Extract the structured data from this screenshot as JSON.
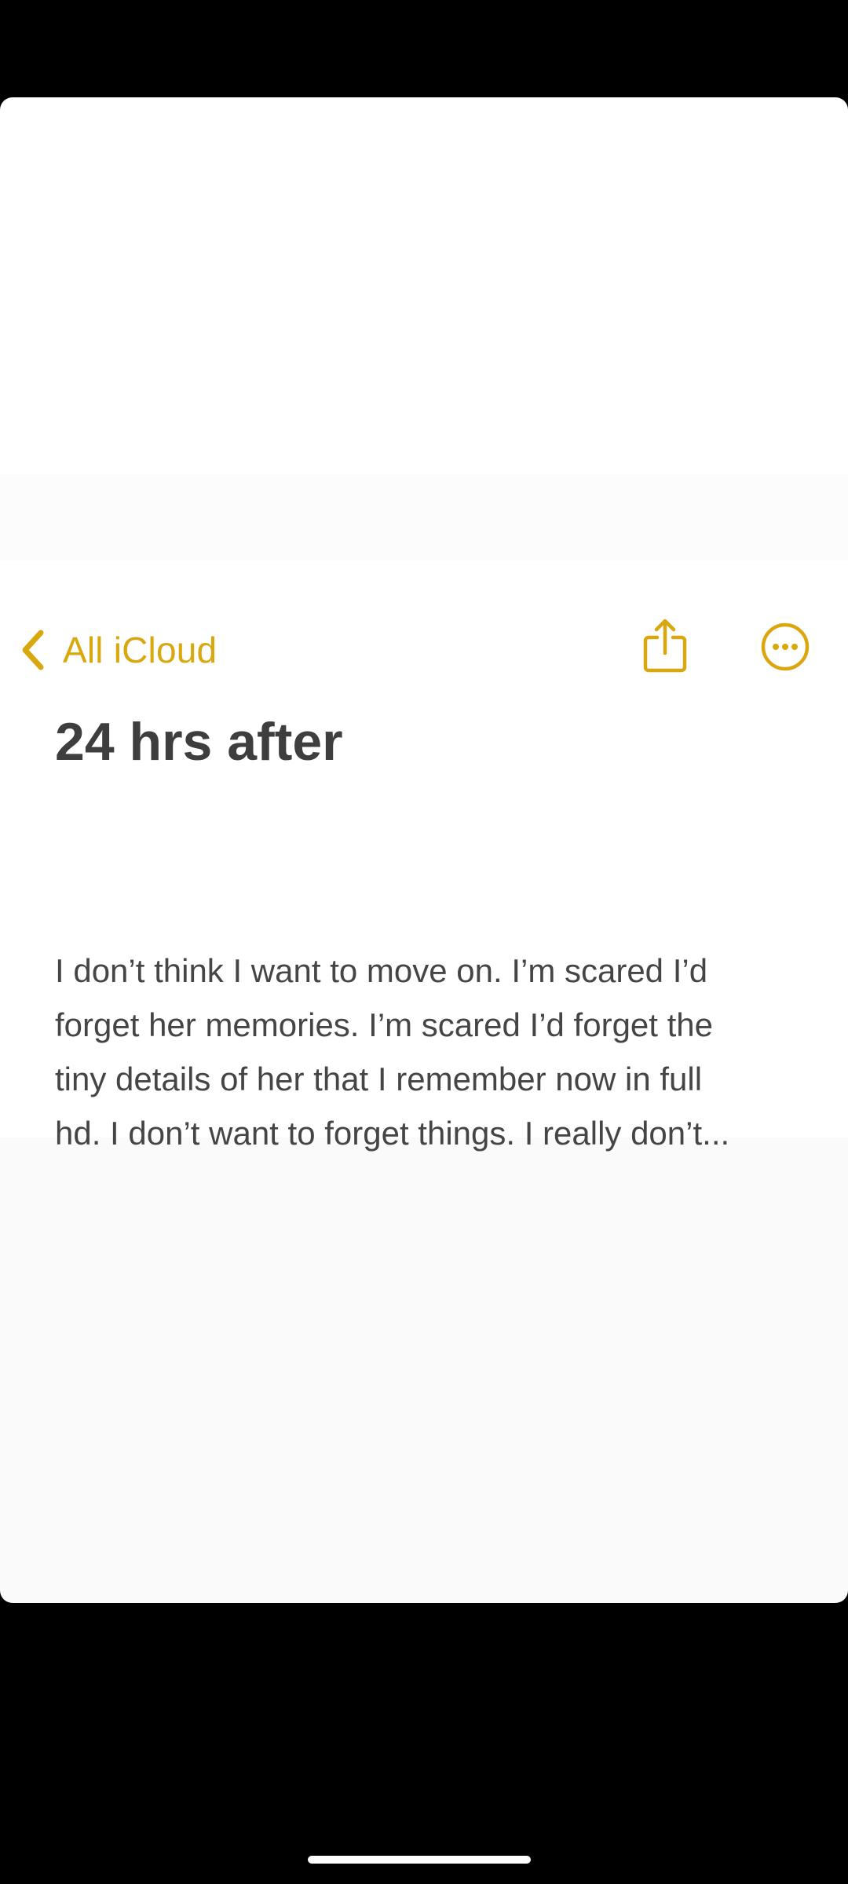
{
  "colors": {
    "accent": "#d8a80e",
    "title_text": "#3e3e3e",
    "body_text": "#454545",
    "background": "#ffffff",
    "frame": "#000000"
  },
  "nav": {
    "back_label": "All iCloud",
    "back_icon": "chevron-left-icon",
    "share_icon": "share-icon",
    "more_icon": "ellipsis-circle-icon"
  },
  "note": {
    "title": "24 hrs after",
    "body_lines": [
      "I don’t think I want to move on. I’m scared I’d",
      "forget her memories. I’m scared I’d forget the",
      "tiny details of her that I remember now in full",
      "hd. I don’t want to forget things. I really don’t..."
    ]
  }
}
